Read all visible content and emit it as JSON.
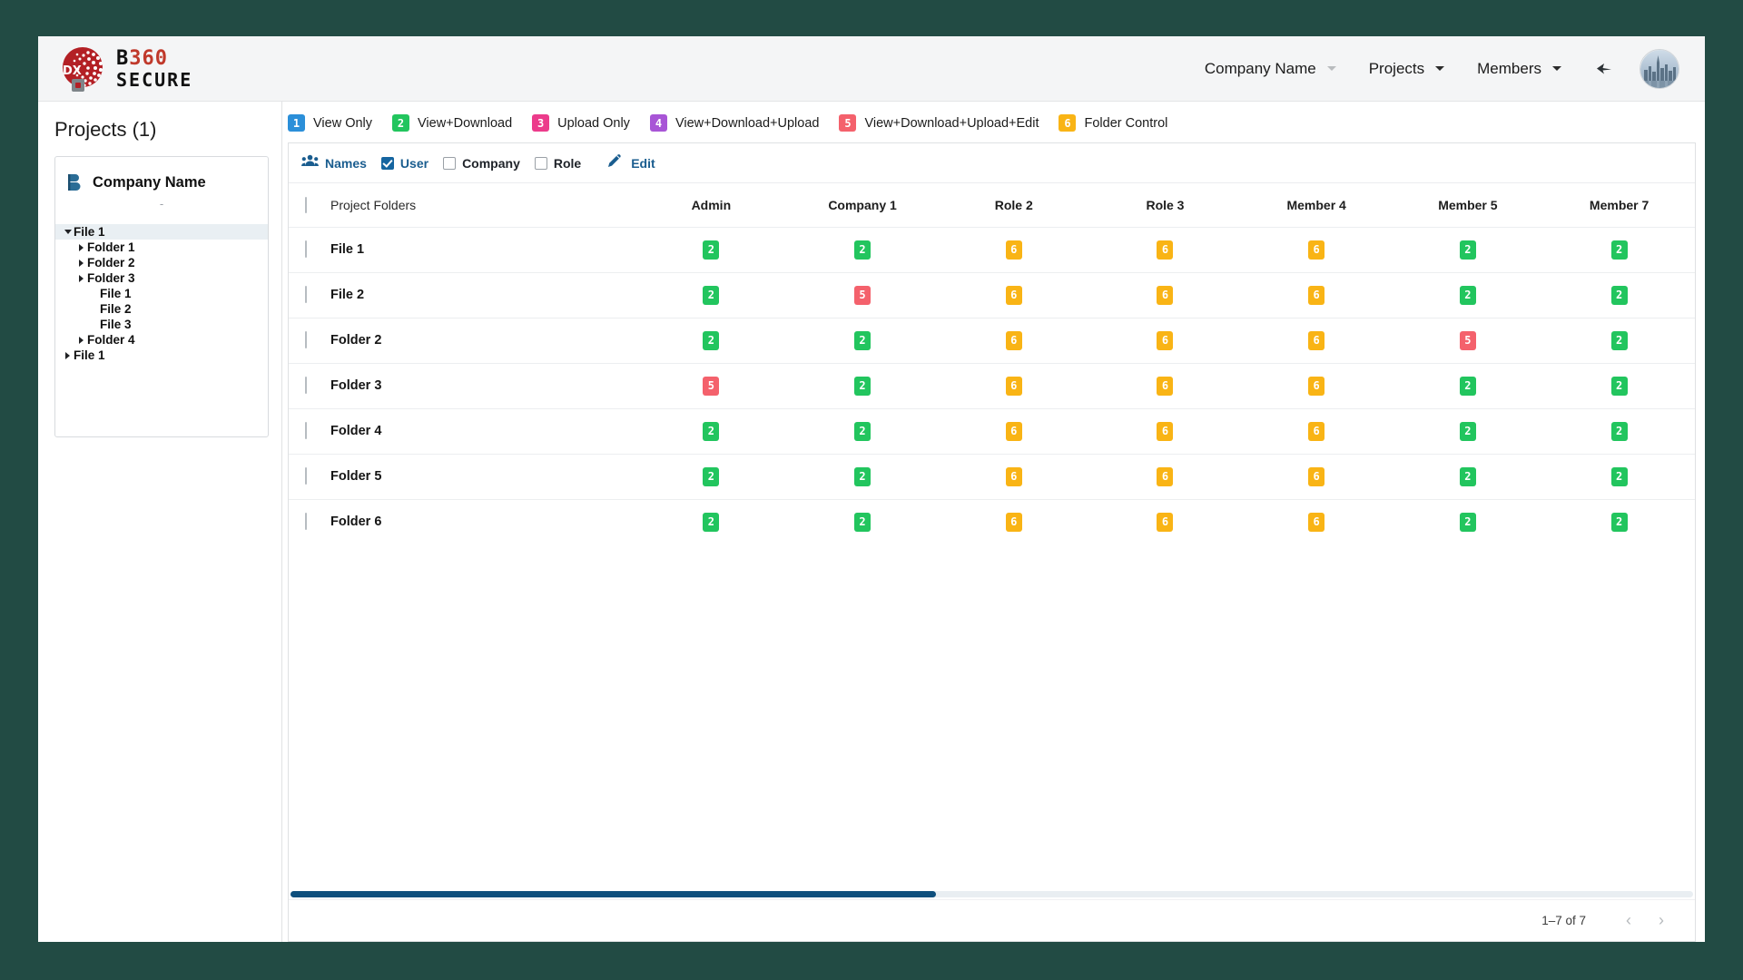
{
  "brand": {
    "line1_b": "B",
    "line1_num": "360",
    "line2": "SECURE",
    "globe_text": "DX"
  },
  "topnav": {
    "items": [
      {
        "label": "Company Name",
        "icon": "chevron-down-icon",
        "caret": "dim"
      },
      {
        "label": "Projects",
        "icon": "chevron-down-icon",
        "caret": "solid"
      },
      {
        "label": "Members",
        "icon": "chevron-down-icon",
        "caret": "solid"
      }
    ],
    "back_icon": "back-arrow-icon",
    "avatar_icon": "user-avatar"
  },
  "sidebar": {
    "title": "Projects (1)",
    "company": {
      "name": "Company Name",
      "icon": "bim-b-icon",
      "sub": "-"
    },
    "tree": [
      {
        "label": "File 1",
        "level": 0,
        "twisty": "down",
        "selected": true
      },
      {
        "label": "Folder 1",
        "level": 1,
        "twisty": "right",
        "selected": false
      },
      {
        "label": "Folder 2",
        "level": 1,
        "twisty": "right",
        "selected": false
      },
      {
        "label": "Folder 3",
        "level": 1,
        "twisty": "right",
        "selected": false
      },
      {
        "label": "File 1",
        "level": 2,
        "twisty": "none",
        "selected": false
      },
      {
        "label": "File 2",
        "level": 2,
        "twisty": "none",
        "selected": false
      },
      {
        "label": "File 3",
        "level": 2,
        "twisty": "none",
        "selected": false
      },
      {
        "label": "Folder 4",
        "level": 1,
        "twisty": "right",
        "selected": false
      },
      {
        "label": "File 1",
        "level": 0,
        "twisty": "right",
        "selected": false
      }
    ]
  },
  "legend": [
    {
      "num": "1",
      "label": "View Only",
      "color": "#2b8fd9"
    },
    {
      "num": "2",
      "label": "View+Download",
      "color": "#22c55e"
    },
    {
      "num": "3",
      "label": "Upload Only",
      "color": "#ec3b8b"
    },
    {
      "num": "4",
      "label": "View+Download+Upload",
      "color": "#a855d6"
    },
    {
      "num": "5",
      "label": "View+Download+Upload+Edit",
      "color": "#f4616c"
    },
    {
      "num": "6",
      "label": "Folder Control",
      "color": "#f9b415"
    }
  ],
  "filterbar": {
    "names_label": "Names",
    "names_icon": "people-icon",
    "checkboxes": [
      {
        "label": "User",
        "checked": true
      },
      {
        "label": "Company",
        "checked": false
      },
      {
        "label": "Role",
        "checked": false
      }
    ],
    "edit_label": "Edit",
    "edit_icon": "pencil-icon"
  },
  "table": {
    "columns": [
      "Project Folders",
      "Admin",
      "Company 1",
      "Role 2",
      "Role  3",
      "Member 4",
      "Member 5",
      "Member 7"
    ],
    "header_checkbox": false,
    "rows": [
      {
        "name": "File 1",
        "checked": false,
        "perms": [
          "2",
          "2",
          "6",
          "6",
          "6",
          "2",
          "2"
        ]
      },
      {
        "name": "File 2",
        "checked": false,
        "perms": [
          "2",
          "5",
          "6",
          "6",
          "6",
          "2",
          "2"
        ]
      },
      {
        "name": "Folder 2",
        "checked": false,
        "perms": [
          "2",
          "2",
          "6",
          "6",
          "6",
          "5",
          "2"
        ]
      },
      {
        "name": "Folder 3",
        "checked": false,
        "perms": [
          "5",
          "2",
          "6",
          "6",
          "6",
          "2",
          "2"
        ]
      },
      {
        "name": "Folder 4",
        "checked": false,
        "perms": [
          "2",
          "2",
          "6",
          "6",
          "6",
          "2",
          "2"
        ]
      },
      {
        "name": "Folder 5",
        "checked": false,
        "perms": [
          "2",
          "2",
          "6",
          "6",
          "6",
          "2",
          "2"
        ]
      },
      {
        "name": "Folder 6",
        "checked": false,
        "perms": [
          "2",
          "2",
          "6",
          "6",
          "6",
          "2",
          "2"
        ]
      }
    ],
    "perm_colors": {
      "1": "#2b8fd9",
      "2": "#22c55e",
      "3": "#ec3b8b",
      "4": "#a855d6",
      "5": "#f4616c",
      "6": "#f9b415"
    },
    "scroll_percent": 46
  },
  "footer": {
    "page_count": "1–7 of 7",
    "prev_icon": "chevron-left-icon",
    "prev_glyph": "‹",
    "next_icon": "chevron-right-icon",
    "next_glyph": "›"
  },
  "colors": {
    "page_background": "#224b44",
    "topbar": "#f4f5f6",
    "accent_blue": "#1a5d8f",
    "scroll_thumb": "#0e4f7d"
  }
}
